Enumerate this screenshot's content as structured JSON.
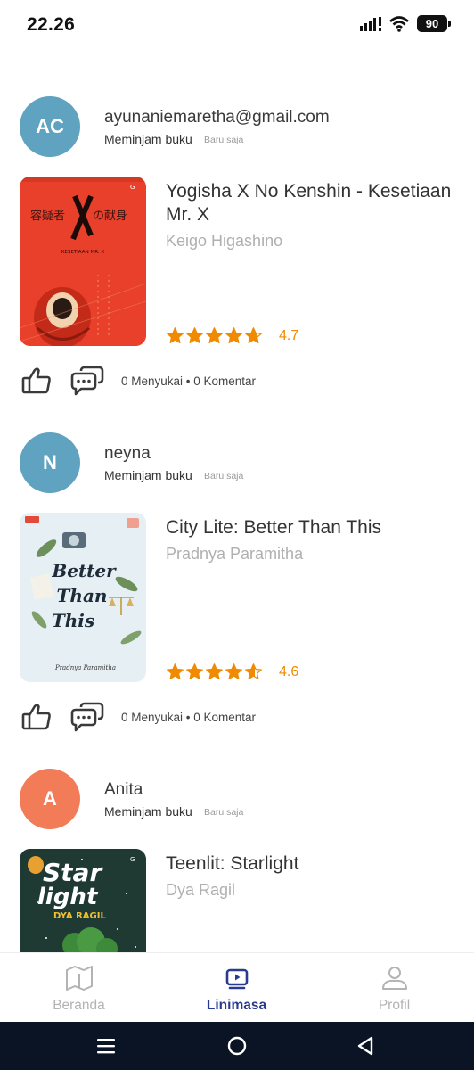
{
  "status_bar": {
    "time": "22.26",
    "battery": "90"
  },
  "posts": [
    {
      "avatar_initials": "AC",
      "avatar_color": "#5fa3c0",
      "user": "ayunaniemaretha@gmail.com",
      "activity": "Meminjam buku",
      "time_ago": "Baru saja",
      "book": {
        "title": "Yogisha X No Kenshin - Kesetiaan Mr. X",
        "author": "Keigo Higashino",
        "rating": "4.7",
        "stars": 4.7,
        "cover_text_title": "容疑者X の献身",
        "cover_text_sub": "KESETIAAN MR. X"
      },
      "stats": "0 Menyukai • 0 Komentar"
    },
    {
      "avatar_initials": "N",
      "avatar_color": "#5fa3c0",
      "user": "neyna",
      "activity": "Meminjam buku",
      "time_ago": "Baru saja",
      "book": {
        "title": "City Lite: Better Than This",
        "author": "Pradnya Paramitha",
        "rating": "4.6",
        "stars": 4.6,
        "cover_text_title": "Better Than This",
        "cover_text_sub": "Pradnya Paramitha"
      },
      "stats": "0 Menyukai • 0 Komentar"
    },
    {
      "avatar_initials": "A",
      "avatar_color": "#f27c58",
      "user": "Anita",
      "activity": "Meminjam buku",
      "time_ago": "Baru saja",
      "book": {
        "title": "Teenlit: Starlight",
        "author": "Dya Ragil",
        "cover_text_title": "Star light",
        "cover_text_sub": "DYA RAGIL"
      }
    }
  ],
  "bottom_nav": {
    "items": [
      {
        "label": "Beranda",
        "icon": "map-book-icon"
      },
      {
        "label": "Linimasa",
        "icon": "video-icon",
        "active": true
      },
      {
        "label": "Profil",
        "icon": "profile-icon"
      }
    ]
  },
  "colors": {
    "accent": "#2a3b8f",
    "star": "#f08a00",
    "cover1": "#e8402a",
    "cover3": "#1f3a33"
  }
}
